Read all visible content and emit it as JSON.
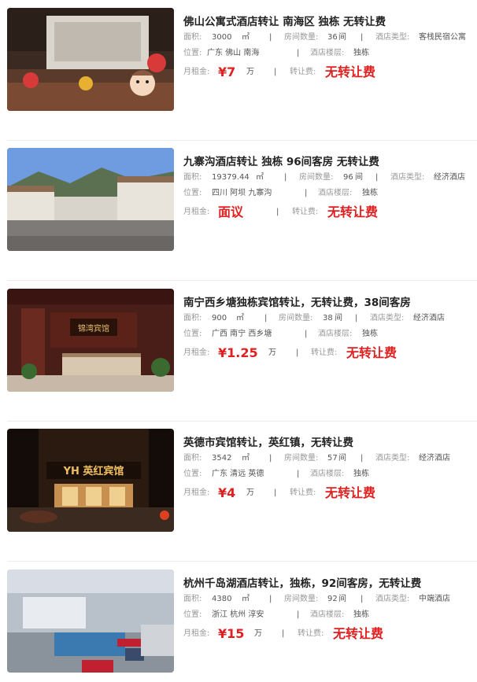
{
  "labels": {
    "area": "面积:",
    "rooms": "房间数量:",
    "hotel_type": "酒店类型:",
    "location": "位置:",
    "floor": "酒店楼层:",
    "rent": "月租金:",
    "transfer_fee": "转让费:",
    "area_unit": "㎡",
    "room_unit": "间",
    "rent_unit": "万",
    "separator": "|"
  },
  "listings": [
    {
      "title": "佛山公寓式酒店转让 南海区 独栋 无转让费",
      "area": "3000",
      "rooms": "36",
      "hotel_type": "客栈民宿公寓",
      "location": "广东 佛山 南海",
      "floor": "独栋",
      "rent": "¥7",
      "rent_unit": "万",
      "transfer_fee": "无转让费"
    },
    {
      "title": "九寨沟酒店转让 独栋 96间客房 无转让费",
      "area": "19379.44",
      "rooms": "96",
      "hotel_type": "经济酒店",
      "location": "四川 阿坝 九寨沟",
      "floor": "独栋",
      "rent": "面议",
      "rent_unit": "",
      "transfer_fee": "无转让费"
    },
    {
      "title": "南宁西乡塘独栋宾馆转让，无转让费，38间客房",
      "area": "900",
      "rooms": "38",
      "hotel_type": "经济酒店",
      "location": "广西 南宁 西乡塘",
      "floor": "独栋",
      "rent": "¥1.25",
      "rent_unit": "万",
      "transfer_fee": "无转让费"
    },
    {
      "title": "英德市宾馆转让，英红镇，无转让费",
      "area": "3542",
      "rooms": "57",
      "hotel_type": "经济酒店",
      "location": "广东 清远 英德",
      "floor": "独栋",
      "rent": "¥4",
      "rent_unit": "万",
      "transfer_fee": "无转让费"
    },
    {
      "title": "杭州千岛湖酒店转让，独栋，92间客房，无转让费",
      "area": "4380",
      "rooms": "92",
      "hotel_type": "中端酒店",
      "location": "浙江 杭州 淳安",
      "floor": "独栋",
      "rent": "¥15",
      "rent_unit": "万",
      "transfer_fee": "无转让费"
    }
  ],
  "image_signs": {
    "listing_3": "锦湾宾馆",
    "listing_4": "YH 英红宾馆"
  },
  "colors": {
    "price_red": "#e02020",
    "title": "#222222",
    "label_gray": "#999999",
    "divider": "#ececec"
  }
}
